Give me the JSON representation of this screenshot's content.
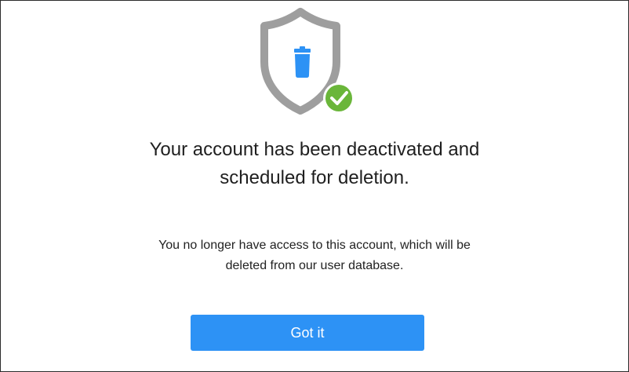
{
  "dialog": {
    "title": "Your account has been deactivated and\nscheduled for deletion.",
    "message": "You no longer have access to this account, which will be\ndeleted from our user database.",
    "button_label": "Got it"
  },
  "icons": {
    "main": "shield-trash-icon",
    "badge": "check-badge-icon"
  },
  "colors": {
    "shield": "#9e9e9e",
    "trash": "#2d92f5",
    "check_badge": "#6ab63a",
    "button": "#2d92f5"
  }
}
